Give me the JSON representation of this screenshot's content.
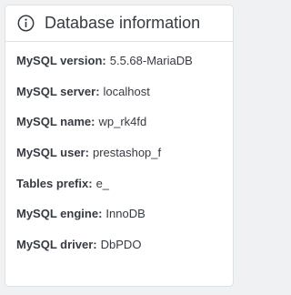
{
  "card": {
    "title": "Database information",
    "icon": "info-icon"
  },
  "rows": [
    {
      "label": "MySQL version",
      "value": "5.5.68-MariaDB"
    },
    {
      "label": "MySQL server",
      "value": "localhost"
    },
    {
      "label": "MySQL name",
      "value": "wp_rk4fd"
    },
    {
      "label": "MySQL user",
      "value": "prestashop_f"
    },
    {
      "label": "Tables prefix",
      "value": "e_"
    },
    {
      "label": "MySQL engine",
      "value": "InnoDB"
    },
    {
      "label": "MySQL driver",
      "value": "DbPDO"
    }
  ],
  "colors": {
    "text": "#363a41",
    "border": "#dbe2e6",
    "background": "#eff1f2",
    "card": "#ffffff"
  }
}
